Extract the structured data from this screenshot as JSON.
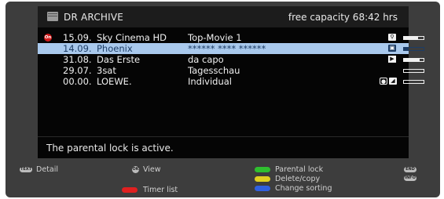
{
  "header": {
    "title": "DR ARCHIVE",
    "capacity": "free capacity 68:42 hrs",
    "icon": "archive-folder-icon"
  },
  "recordings": [
    {
      "date": "15.09.",
      "station": "Sky Cinema HD",
      "programme": "Top-Movie 1",
      "status_icon": "key-icon",
      "fill": 0.7,
      "new_badge": "On",
      "selected": false
    },
    {
      "date": "14.09.",
      "station": "Phoenix",
      "programme": "****** **** ******",
      "status_icon": "lock-icon",
      "fill": 0.25,
      "new_badge": "",
      "selected": true
    },
    {
      "date": "31.08.",
      "station": "Das Erste",
      "programme": "da capo",
      "status_icon": "play-icon",
      "fill": 0.8,
      "new_badge": "",
      "selected": false
    },
    {
      "date": "29.07.",
      "station": "3sat",
      "programme": "Tagesschau",
      "status_icon": "",
      "fill": 0,
      "new_badge": "",
      "selected": false
    },
    {
      "date": "00.00.",
      "station": "LOEWE.",
      "programme": "Individual",
      "status_icon": "circle-half-icons",
      "fill": 0,
      "new_badge": "",
      "selected": false
    }
  ],
  "status_message": "The parental lock is active.",
  "footer": {
    "detail": {
      "key": "TEXT",
      "label": "Detail"
    },
    "view": {
      "key": "OK",
      "label": "View"
    },
    "timer": {
      "key": "red",
      "label": "Timer list"
    },
    "parental": {
      "key": "green",
      "label": "Parental lock"
    },
    "delete": {
      "key": "yellow",
      "label": "Delete/copy"
    },
    "sorting": {
      "key": "blue",
      "label": "Change sorting"
    },
    "end": {
      "key": "END"
    },
    "info": {
      "key": "INFO"
    }
  },
  "colors": {
    "selection": "#a9c9ed",
    "selection_text": "#1d3d66",
    "red_key": "#e02020",
    "green_key": "#2fbf2f",
    "yellow_key": "#e0d020",
    "blue_key": "#3060e0"
  }
}
